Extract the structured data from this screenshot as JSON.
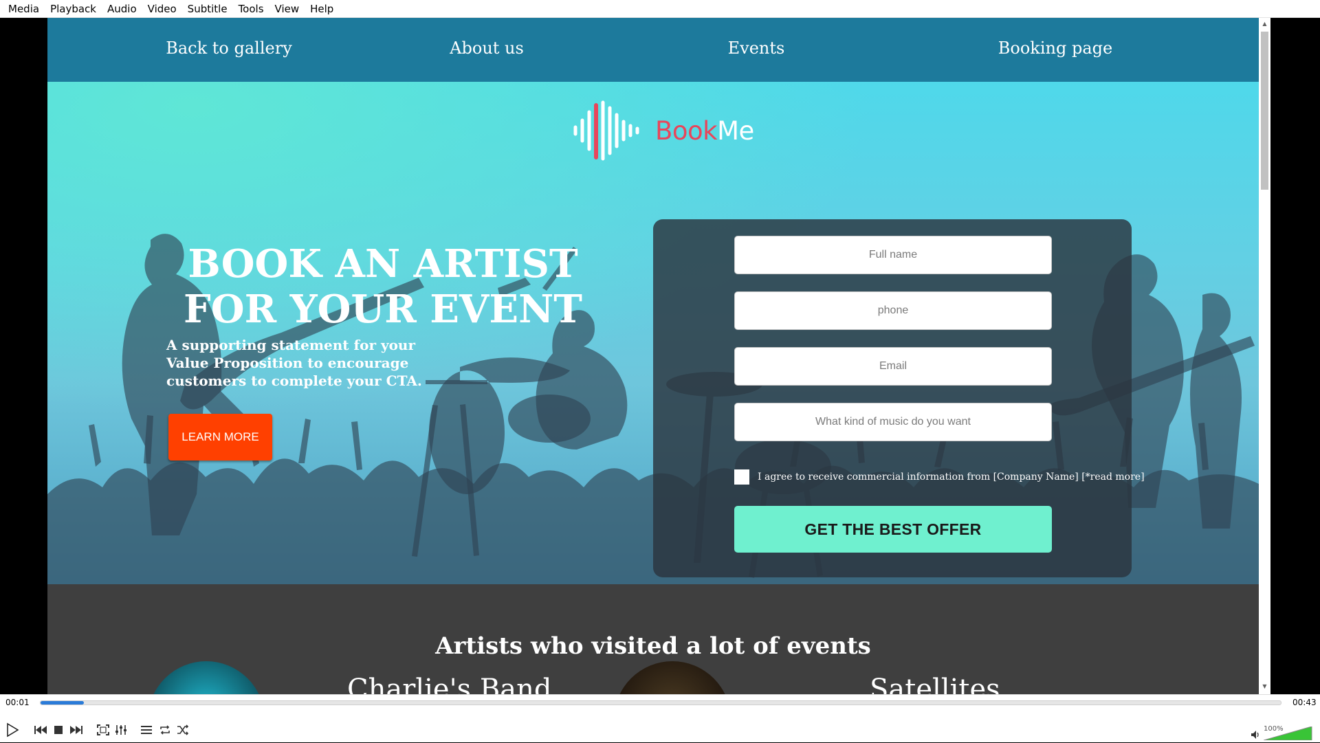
{
  "menu": [
    "Media",
    "Playback",
    "Audio",
    "Video",
    "Subtitle",
    "Tools",
    "View",
    "Help"
  ],
  "site": {
    "nav": [
      "Back to gallery",
      "About us",
      "Events",
      "Booking page"
    ],
    "logo": {
      "part1": "Book",
      "part2": "Me"
    },
    "hero": {
      "headline_line1": "BOOK AN ARTIST",
      "headline_line2": "FOR YOUR EVENT",
      "support": "A supporting statement for your Value Proposition to encourage customers to complete your CTA.",
      "learn_more": "LEARN MORE"
    },
    "form": {
      "full_name_placeholder": "Full name",
      "phone_placeholder": "phone",
      "email_placeholder": "Email",
      "music_placeholder": "What kind of music do you want",
      "consent": "I agree to receive commercial information from [Company Name] [*read more]",
      "consent_checked": false,
      "submit": "GET THE BEST OFFER"
    },
    "artists": {
      "title": "Artists who visited a lot of events",
      "items": [
        "Charlie's Band",
        "Satellites"
      ]
    }
  },
  "player": {
    "time_elapsed": "00:01",
    "time_total": "00:43",
    "progress_fraction": 0.035,
    "volume": "100%",
    "volume_fraction": 1.0
  },
  "colors": {
    "nav_bg": "#1d7a9c",
    "cta_orange": "#ff4000",
    "offer_green": "#6ff0cf",
    "logo_red": "#e8465b",
    "seek_blue": "#2a7bd8"
  }
}
